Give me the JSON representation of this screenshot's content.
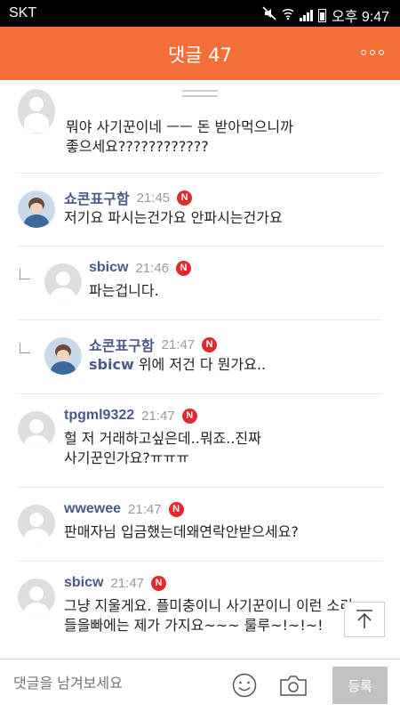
{
  "status_bar": {
    "carrier": "SKT",
    "time": "오후 9:47"
  },
  "header": {
    "title": "댓글 47",
    "more_icon": "more-dots-icon"
  },
  "comments": [
    {
      "nickname": "",
      "time": "",
      "text": [
        "뭐야 사기꾼이네 ㅡㅡ 돈 받아먹으니까",
        "좋으세요????????????"
      ],
      "reply": false
    },
    {
      "nickname": "쇼콘표구함",
      "time": "21:45",
      "badge": "N",
      "text": [
        "저기요 파시는건가요 안파시는건가요"
      ],
      "reply": false
    },
    {
      "nickname": "sbicw",
      "time": "21:46",
      "badge": "N",
      "text": [
        "파는겁니다."
      ],
      "reply": true
    },
    {
      "nickname": "쇼콘표구함",
      "time": "21:47",
      "badge": "N",
      "mention": "sbicw",
      "text": [
        "위에 저건 다 뭔가요.."
      ],
      "reply": true
    },
    {
      "nickname": "tpgml9322",
      "time": "21:47",
      "badge": "N",
      "text": [
        "헐 저 거래하고싶은데..뭐죠..진짜",
        "사기꾼인가요?ㅠㅠㅠ"
      ],
      "reply": false
    },
    {
      "nickname": "wwewee",
      "time": "21:47",
      "badge": "N",
      "text": [
        "판매자님 입금했는데왜연락안받으세요?"
      ],
      "reply": false
    },
    {
      "nickname": "sbicw",
      "time": "21:47",
      "badge": "N",
      "text": [
        "그냥 지울게요. 플미충이니 사기꾼이니 이런 소리",
        "들을빠에는 제가 가지요~~~ 룰루~!~!~!"
      ],
      "reply": false
    }
  ],
  "input_bar": {
    "placeholder": "댓글을 남겨보세요",
    "submit_label": "등록",
    "emoji_icon": "emoji-icon",
    "camera_icon": "camera-icon"
  },
  "colors": {
    "header": "#f26f3a",
    "badge": "#e6272d",
    "nickname": "#4a5a88",
    "submit_bg": "#c2c2c2"
  }
}
